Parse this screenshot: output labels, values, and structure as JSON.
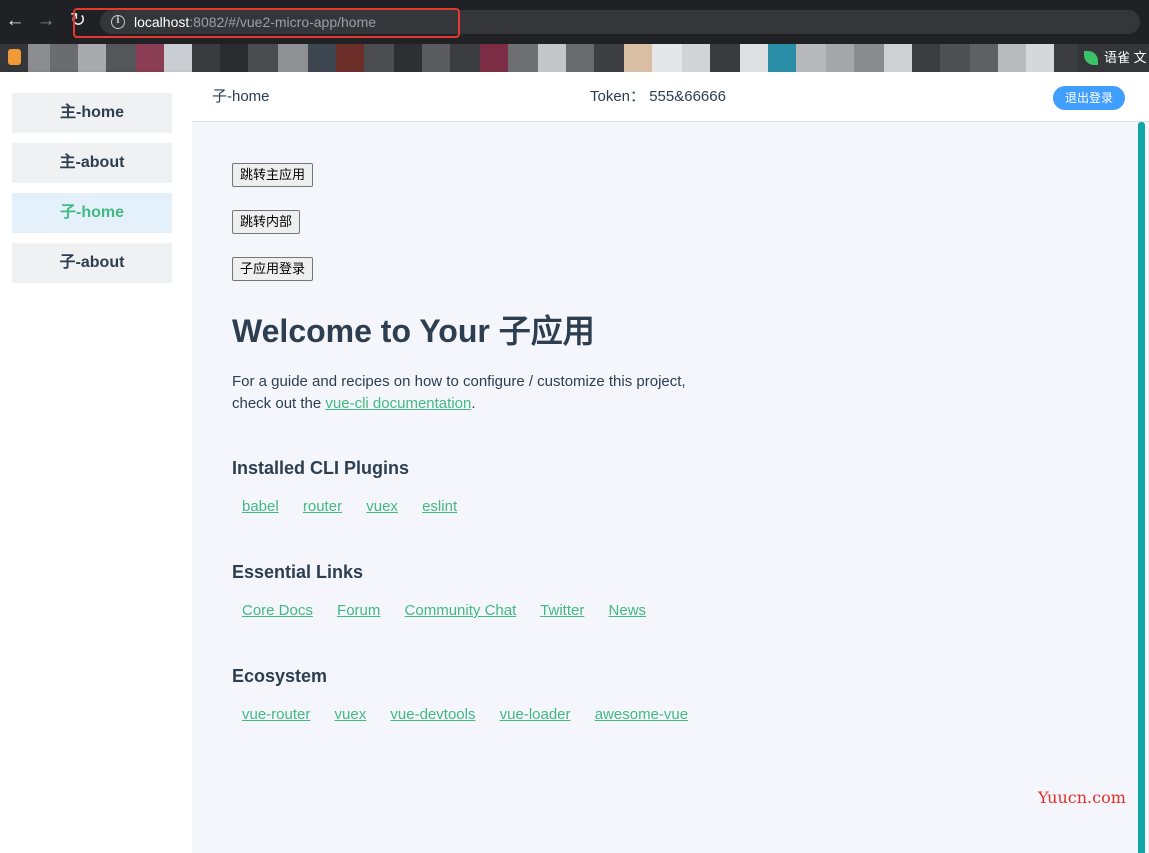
{
  "browser": {
    "url_host": "localhost",
    "url_rest": ":8082/#/vue2-micro-app/home",
    "bookmark_right_label": "语雀 文"
  },
  "sidebar": {
    "items": [
      {
        "label": "主-home"
      },
      {
        "label": "主-about"
      },
      {
        "label": "子-home"
      },
      {
        "label": "子-about"
      }
    ]
  },
  "header": {
    "title": "子-home",
    "token_label": "Token：",
    "token_value": "555&66666",
    "logout_label": "退出登录"
  },
  "main": {
    "buttons": [
      "跳转主应用",
      "跳转内部",
      "子应用登录"
    ],
    "welcome": "Welcome to Your 子应用",
    "intro_line1": "For a guide and recipes on how to configure / customize this project,",
    "intro_prefix": "check out the ",
    "intro_link": "vue-cli documentation",
    "intro_suffix": ".",
    "sections": [
      {
        "title": "Installed CLI Plugins",
        "links": [
          "babel",
          "router",
          "vuex",
          "eslint"
        ]
      },
      {
        "title": "Essential Links",
        "links": [
          "Core Docs",
          "Forum",
          "Community Chat",
          "Twitter",
          "News"
        ]
      },
      {
        "title": "Ecosystem",
        "links": [
          "vue-router",
          "vuex",
          "vue-devtools",
          "vue-loader",
          "awesome-vue"
        ]
      }
    ]
  },
  "watermark": "Yuucn.com",
  "colors": {
    "accent_green": "#42b983",
    "logout_blue": "#409eff",
    "scrollbar_teal": "#0fa6a5",
    "highlight_red": "#e23b2e"
  }
}
